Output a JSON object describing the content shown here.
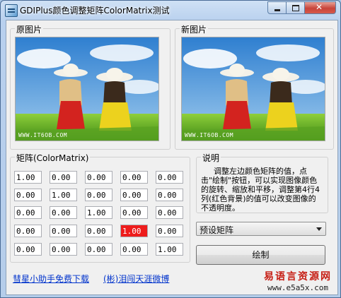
{
  "window": {
    "title": "GDIPlus颜色调整矩阵ColorMatrix测试"
  },
  "original": {
    "label": "原图片",
    "watermark": "WWW.IT6OB.COM"
  },
  "modified": {
    "label": "新图片",
    "watermark": "WWW.IT6OB.COM"
  },
  "matrix": {
    "label": "矩阵(ColorMatrix)",
    "rows": [
      [
        "1.00",
        "0.00",
        "0.00",
        "0.00",
        "0.00"
      ],
      [
        "0.00",
        "1.00",
        "0.00",
        "0.00",
        "0.00"
      ],
      [
        "0.00",
        "0.00",
        "1.00",
        "0.00",
        "0.00"
      ],
      [
        "0.00",
        "0.00",
        "0.00",
        "1.00",
        "0.00"
      ],
      [
        "0.00",
        "0.00",
        "0.00",
        "0.00",
        "1.00"
      ]
    ],
    "highlight_color": "#ee1c1c"
  },
  "description": {
    "label": "说明",
    "text": "调整左边颜色矩阵的值，点击\"绘制\"按钮，可以实现图像颜色的旋转、缩放和平移，调整第4行4列(红色背景)的值可以改变图像的不透明度。"
  },
  "preset": {
    "selected": "预设矩阵"
  },
  "draw_button": {
    "label": "绘制"
  },
  "links": {
    "left": "彗星小助手免费下载",
    "right": "(彬)泪闯天涯微博"
  },
  "brand": {
    "name": "易语言资源网",
    "url": "www.e5a5x.com"
  },
  "colors": {
    "link": "#0033cc",
    "brand": "#c61d13"
  }
}
